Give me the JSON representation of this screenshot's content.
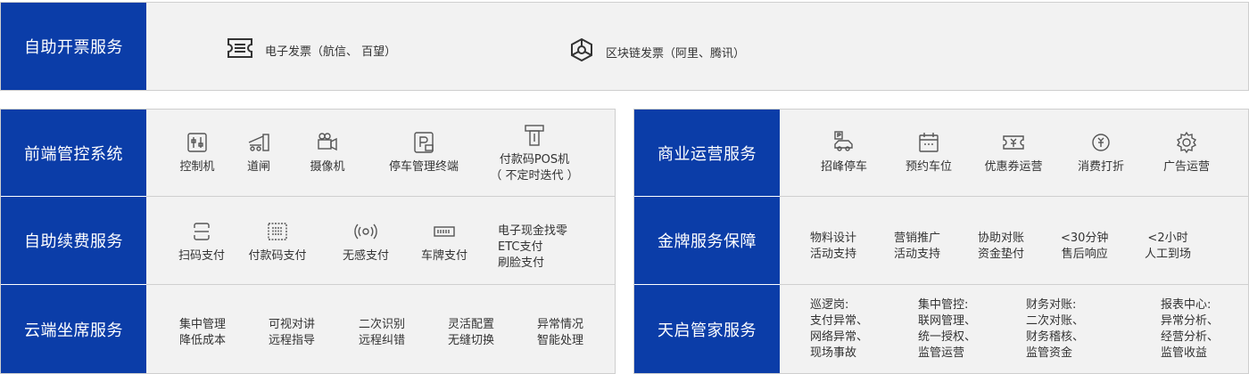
{
  "top": {
    "header": "自助开票服务",
    "items": [
      {
        "label": "电子发票（航信、 百望）",
        "icon": "invoice-icon"
      },
      {
        "label": "区块链发票（阿里、腾讯）",
        "icon": "blockchain-icon"
      }
    ]
  },
  "left": {
    "rows": [
      {
        "header": "前端管控系统",
        "items": [
          {
            "label": "控制机",
            "icon": "controller-icon"
          },
          {
            "label": "道闸",
            "icon": "barrier-gate-icon"
          },
          {
            "label": "摄像机",
            "icon": "camera-icon"
          },
          {
            "label": "停车管理终端",
            "icon": "parking-terminal-icon"
          },
          {
            "label": "付款码POS机",
            "label2": "（ 不定时迭代 ）",
            "icon": "pos-machine-icon"
          }
        ]
      },
      {
        "header": "自助续费服务",
        "items": [
          {
            "label": "扫码支付",
            "icon": "scan-icon"
          },
          {
            "label": "付款码支付",
            "icon": "barcode-icon"
          },
          {
            "label": "无感支付",
            "icon": "wireless-icon"
          },
          {
            "label": "车牌支付",
            "icon": "license-plate-icon"
          }
        ],
        "extra": [
          "电子现金找零",
          "ETC支付",
          "刷脸支付"
        ]
      },
      {
        "header": "云端坐席服务",
        "items": [
          [
            "集中管理",
            "降低成本"
          ],
          [
            "可视对讲",
            "远程指导"
          ],
          [
            "二次识别",
            "远程纠错"
          ],
          [
            "灵活配置",
            "无缝切换"
          ],
          [
            "异常情况",
            "智能处理"
          ]
        ]
      }
    ]
  },
  "right": {
    "rows": [
      {
        "header": "商业运营服务",
        "items": [
          {
            "label": "招峰停车",
            "icon": "parking-car-icon"
          },
          {
            "label": "预约车位",
            "icon": "calendar-icon"
          },
          {
            "label": "优惠券运营",
            "icon": "coupon-icon"
          },
          {
            "label": "消费打折",
            "icon": "discount-icon"
          },
          {
            "label": "广告运营",
            "icon": "gear-icon"
          }
        ]
      },
      {
        "header": "金牌服务保障",
        "items": [
          [
            "物料设计",
            "活动支持"
          ],
          [
            "营销推广",
            "活动支持"
          ],
          [
            "协助对账",
            "资金垫付"
          ],
          [
            "<30分钟",
            "售后响应"
          ],
          [
            "<2小时",
            "人工到场"
          ]
        ]
      },
      {
        "header": "天启管家服务",
        "items": [
          {
            "title": "巡逻岗:",
            "lines": [
              "支付异常、",
              "网络异常、",
              "现场事故"
            ]
          },
          {
            "title": "集中管控:",
            "lines": [
              "联网管理、",
              "统一授权、",
              "监管运营"
            ]
          },
          {
            "title": "财务对账:",
            "lines": [
              "二次对账、",
              "财务稽核、",
              "监管资金"
            ]
          },
          {
            "title": "报表中心:",
            "lines": [
              "异常分析、",
              "经营分析、",
              "监管收益"
            ]
          }
        ]
      }
    ]
  },
  "colors": {
    "header_bg": "#0b3da8",
    "panel_bg": "#f2f2f2",
    "border": "#cfcfcf"
  }
}
